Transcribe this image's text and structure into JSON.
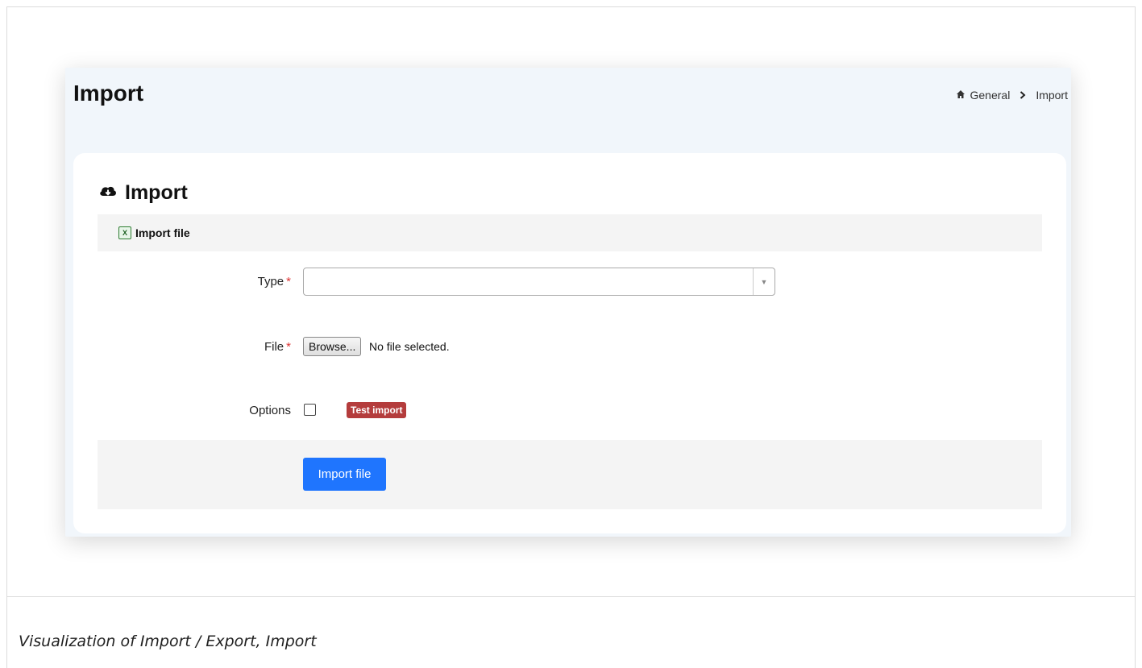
{
  "page": {
    "title": "Import",
    "breadcrumb": {
      "home_icon": "home-icon",
      "items": [
        "General",
        "Import"
      ],
      "separator_icon": "chevron-right-icon"
    }
  },
  "card": {
    "title": "Import",
    "title_icon": "cloud-download-icon",
    "section": {
      "icon": "excel-icon",
      "label": "Import file"
    }
  },
  "form": {
    "type": {
      "label": "Type",
      "required_mark": "*",
      "value": ""
    },
    "file": {
      "label": "File",
      "required_mark": "*",
      "browse_label": "Browse...",
      "status": "No file selected."
    },
    "options": {
      "label": "Options",
      "checked": false,
      "badge": "Test import",
      "badge_color": "#b43c3c"
    }
  },
  "actions": {
    "submit_label": "Import file",
    "submit_color": "#1f75fe"
  },
  "caption": "Visualization of Import / Export, Import"
}
